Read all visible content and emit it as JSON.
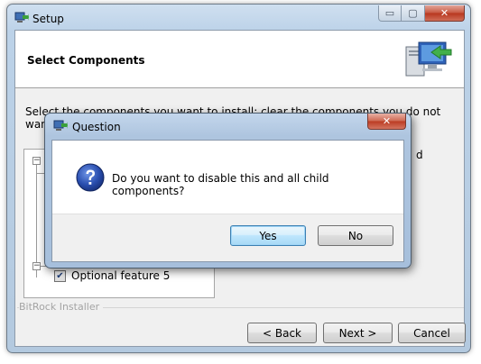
{
  "window": {
    "title": "Setup",
    "controls": {
      "minimize": "▭",
      "maximize": "▢",
      "close": "✕"
    }
  },
  "header": {
    "title": "Select Components"
  },
  "description": "Select the components you want to install; clear the components you do not want to install. Click Next when you are ready to continue.",
  "tree": {
    "visible_item": "Optional feature 5",
    "visible_item_checked": true,
    "right_clipped_text": "d"
  },
  "branding": "BitRock Installer",
  "buttons": {
    "back": "< Back",
    "next": "Next >",
    "cancel": "Cancel"
  },
  "dialog": {
    "title": "Question",
    "message": "Do you want to disable this and all child components?",
    "yes_label": "Yes",
    "no_label": "No",
    "close": "✕"
  },
  "colors": {
    "accent": "#3c7fb1",
    "close_red": "#c7573f",
    "question_blue": "#2a4fb0"
  }
}
